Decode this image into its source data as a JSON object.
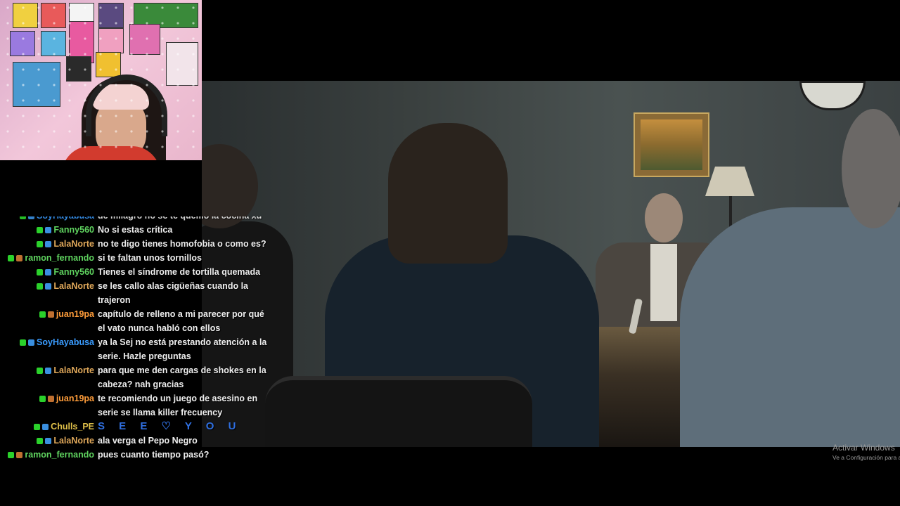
{
  "webcam": {
    "label": "streamer webcam"
  },
  "chat": {
    "messages": [
      {
        "user": "SoyHayabusa",
        "color": "#3a9cff",
        "text": "de milagro no se te quemo la cocina xd",
        "partial": true
      },
      {
        "user": "Fanny560",
        "color": "#5fd35f",
        "text": "No si estas crítica"
      },
      {
        "user": "LalaNorte",
        "color": "#e0a85a",
        "text": "no te digo tienes homofobia o como es?"
      },
      {
        "user": "ramon_fernando",
        "color": "#5fd35f",
        "text": "si te faltan unos tornillos"
      },
      {
        "user": "Fanny560",
        "color": "#5fd35f",
        "text": "Tienes el síndrome de tortilla quemada"
      },
      {
        "user": "LalaNorte",
        "color": "#e0a85a",
        "text": "se les callo alas cigüeñas cuando la trajeron"
      },
      {
        "user": "juan19pa",
        "color": "#ff9d3a",
        "text": "capítulo de relleno a mi parecer por qué el vato nunca habló con ellos"
      },
      {
        "user": "SoyHayabusa",
        "color": "#3a9cff",
        "text": "ya la Sej no está prestando atención a la serie. Hazle preguntas"
      },
      {
        "user": "LalaNorte",
        "color": "#e0a85a",
        "text": "para que me den cargas de shokes en la cabeza? nah gracias"
      },
      {
        "user": "juan19pa",
        "color": "#ff9d3a",
        "text": "te recomiendo un juego de asesino en serie se llama killer frecuency"
      },
      {
        "user": "Chulls_PE",
        "color": "#e0c04a",
        "text": "S E E ♡ Y O U",
        "emote_row": true
      },
      {
        "user": "LalaNorte",
        "color": "#e0a85a",
        "text": "ala verga el Pepo Negro"
      },
      {
        "user": "ramon_fernando",
        "color": "#5fd35f",
        "text": "pues cuanto tiempo pasó?"
      }
    ]
  },
  "watermark": {
    "line1": "Activar Windows",
    "line2": "Ve a Configuración para activar Windows."
  },
  "colors": {
    "background": "#000000",
    "chat_text": "#eeeeee",
    "badge_green": "#2bd12b",
    "badge_blue": "#3a8fe0",
    "badge_pink": "#e07090"
  }
}
